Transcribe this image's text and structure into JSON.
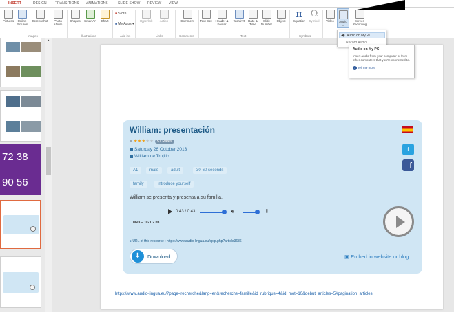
{
  "ribbon_tabs": [
    "INSERT",
    "DESIGN",
    "TRANSITIONS",
    "ANIMATIONS",
    "SLIDE SHOW",
    "REVIEW",
    "VIEW"
  ],
  "ribbon": {
    "images": {
      "group_label": "Images",
      "buttons": [
        "Pictures",
        "Online Pictures",
        "Screenshot",
        "Photo Album"
      ]
    },
    "illustrations": {
      "group_label": "Illustrations",
      "buttons": [
        "Shapes",
        "SmartArt",
        "Chart"
      ]
    },
    "addins": {
      "group_label": "Add-ins",
      "store": "Store",
      "my_apps": "My Apps"
    },
    "links": {
      "group_label": "Links",
      "buttons": [
        "Hyperlink",
        "Action"
      ]
    },
    "comments": {
      "group_label": "Comments",
      "buttons": [
        "Comment"
      ]
    },
    "text": {
      "group_label": "Text",
      "buttons": [
        "Text Box",
        "Header & Footer",
        "WordArt",
        "Date & Time",
        "Slide Number",
        "Object"
      ]
    },
    "symbols": {
      "group_label": "Symbols",
      "buttons": [
        "Equation",
        "Symbol"
      ]
    },
    "media": {
      "buttons": [
        "Video",
        "Audio",
        "Screen Recording"
      ]
    }
  },
  "audio_menu": {
    "items": [
      "Audio on My PC...",
      "Record Audio..."
    ]
  },
  "tooltip": {
    "title": "Audio on My PC",
    "description": "Insert audio from your computer or from other computers that you're connected to.",
    "more": "Tell me more"
  },
  "thumbnails": {
    "number_slide_1": "72 38",
    "number_slide_2": "90 56"
  },
  "card": {
    "title": "William: presentación",
    "rates": "57 Rates",
    "rating": 3,
    "date": "Saturday 26 October 2013",
    "author": "William de Trujillo",
    "tags_row1": [
      "A1",
      "male",
      "adult",
      "30-60 seconds"
    ],
    "tags_row2": [
      "family",
      "introduce yourself"
    ],
    "description": "William se presenta y presenta a su familia.",
    "player_time": "0:43 / 0:43",
    "file_info": "MP3 – 1021.2 kb",
    "url_label": "URL of this resource : https://www.audio-lingua.eu/spip.php?article3636",
    "download": "Download",
    "embed": "Embed in website or blog"
  },
  "bottom_url": "https://www.audio-lingua.eu/?page=recherche&lang=en&recherche=famille&id_rubrique=4&id_mot=10&debut_articles=5#pagination_articles",
  "colors": {
    "accent_tab": "#c0392b",
    "card_bg": "#d0e6f4",
    "title": "#1d5a86",
    "link": "#1a5fa8",
    "thumb_purple": "#6a2c91"
  }
}
